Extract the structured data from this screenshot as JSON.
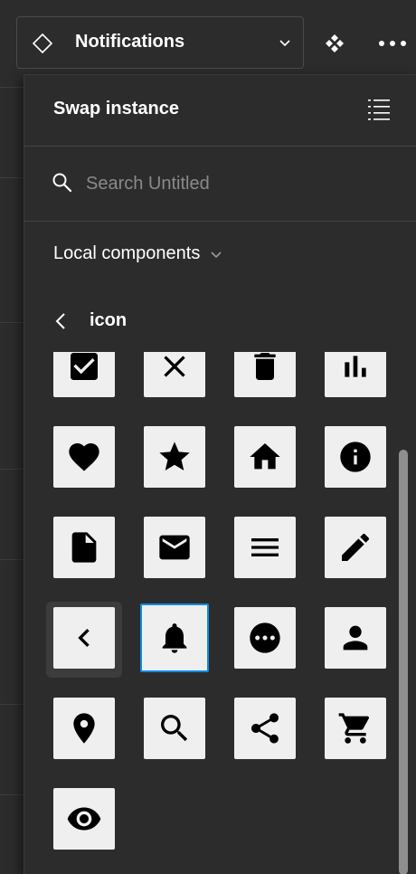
{
  "topbar": {
    "instance_name": "Notifications",
    "icons": [
      "component-diamond-icon",
      "chevron-down-icon",
      "go-to-main-component-icon",
      "more-options-icon"
    ]
  },
  "panel": {
    "title": "Swap instance",
    "search": {
      "placeholder": "Search Untitled",
      "value": ""
    },
    "library_label": "Local components",
    "folder_label": "icon"
  },
  "icons_grid": [
    "checkbox-icon",
    "close-icon",
    "delete-icon",
    "bar-chart-icon",
    "heart-icon",
    "star-icon",
    "home-icon",
    "info-icon",
    "document-icon",
    "mail-icon",
    "menu-icon",
    "edit-icon",
    "chevron-left-icon",
    "bell-icon",
    "more-horizontal-icon",
    "person-icon",
    "location-icon",
    "search-icon",
    "share-icon",
    "cart-icon",
    "eye-icon"
  ],
  "selected_icon": "bell-icon",
  "colors": {
    "background": "#2c2c2c",
    "tile": "#efefef",
    "selection": "#0c8ce9",
    "text": "#ffffff",
    "placeholder": "#8a8a8a"
  }
}
